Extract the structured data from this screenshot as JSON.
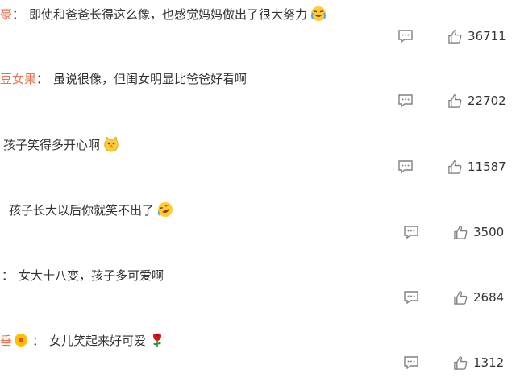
{
  "comments": [
    {
      "user": "豪",
      "text": "即使和爸爸长得这么像，也感觉妈妈做出了很大努力",
      "emoji": "crying-laughing-emoji",
      "likes": "36711"
    },
    {
      "user": "豆女果",
      "text": "虽说很像，但闺女明显比爸爸好看啊",
      "emoji": "",
      "likes": "22702"
    },
    {
      "user": "",
      "text": "孩子笑得多开心啊",
      "emoji": "smirk-cat-emoji",
      "likes": "11587"
    },
    {
      "user": "",
      "text": "孩子长大以后你就笑不出了",
      "emoji": "rolling-laughing-emoji",
      "likes": "3500"
    },
    {
      "user": "",
      "text": "女大十八变，孩子多可爱啊",
      "emoji": "",
      "likes": "2684"
    },
    {
      "user": "垂",
      "text": "女儿笑起来好可爱",
      "emoji": "rose-emoji",
      "likes": "1312"
    }
  ],
  "colors": {
    "username": "#eb7350",
    "icon": "#808080",
    "text": "#333333"
  }
}
